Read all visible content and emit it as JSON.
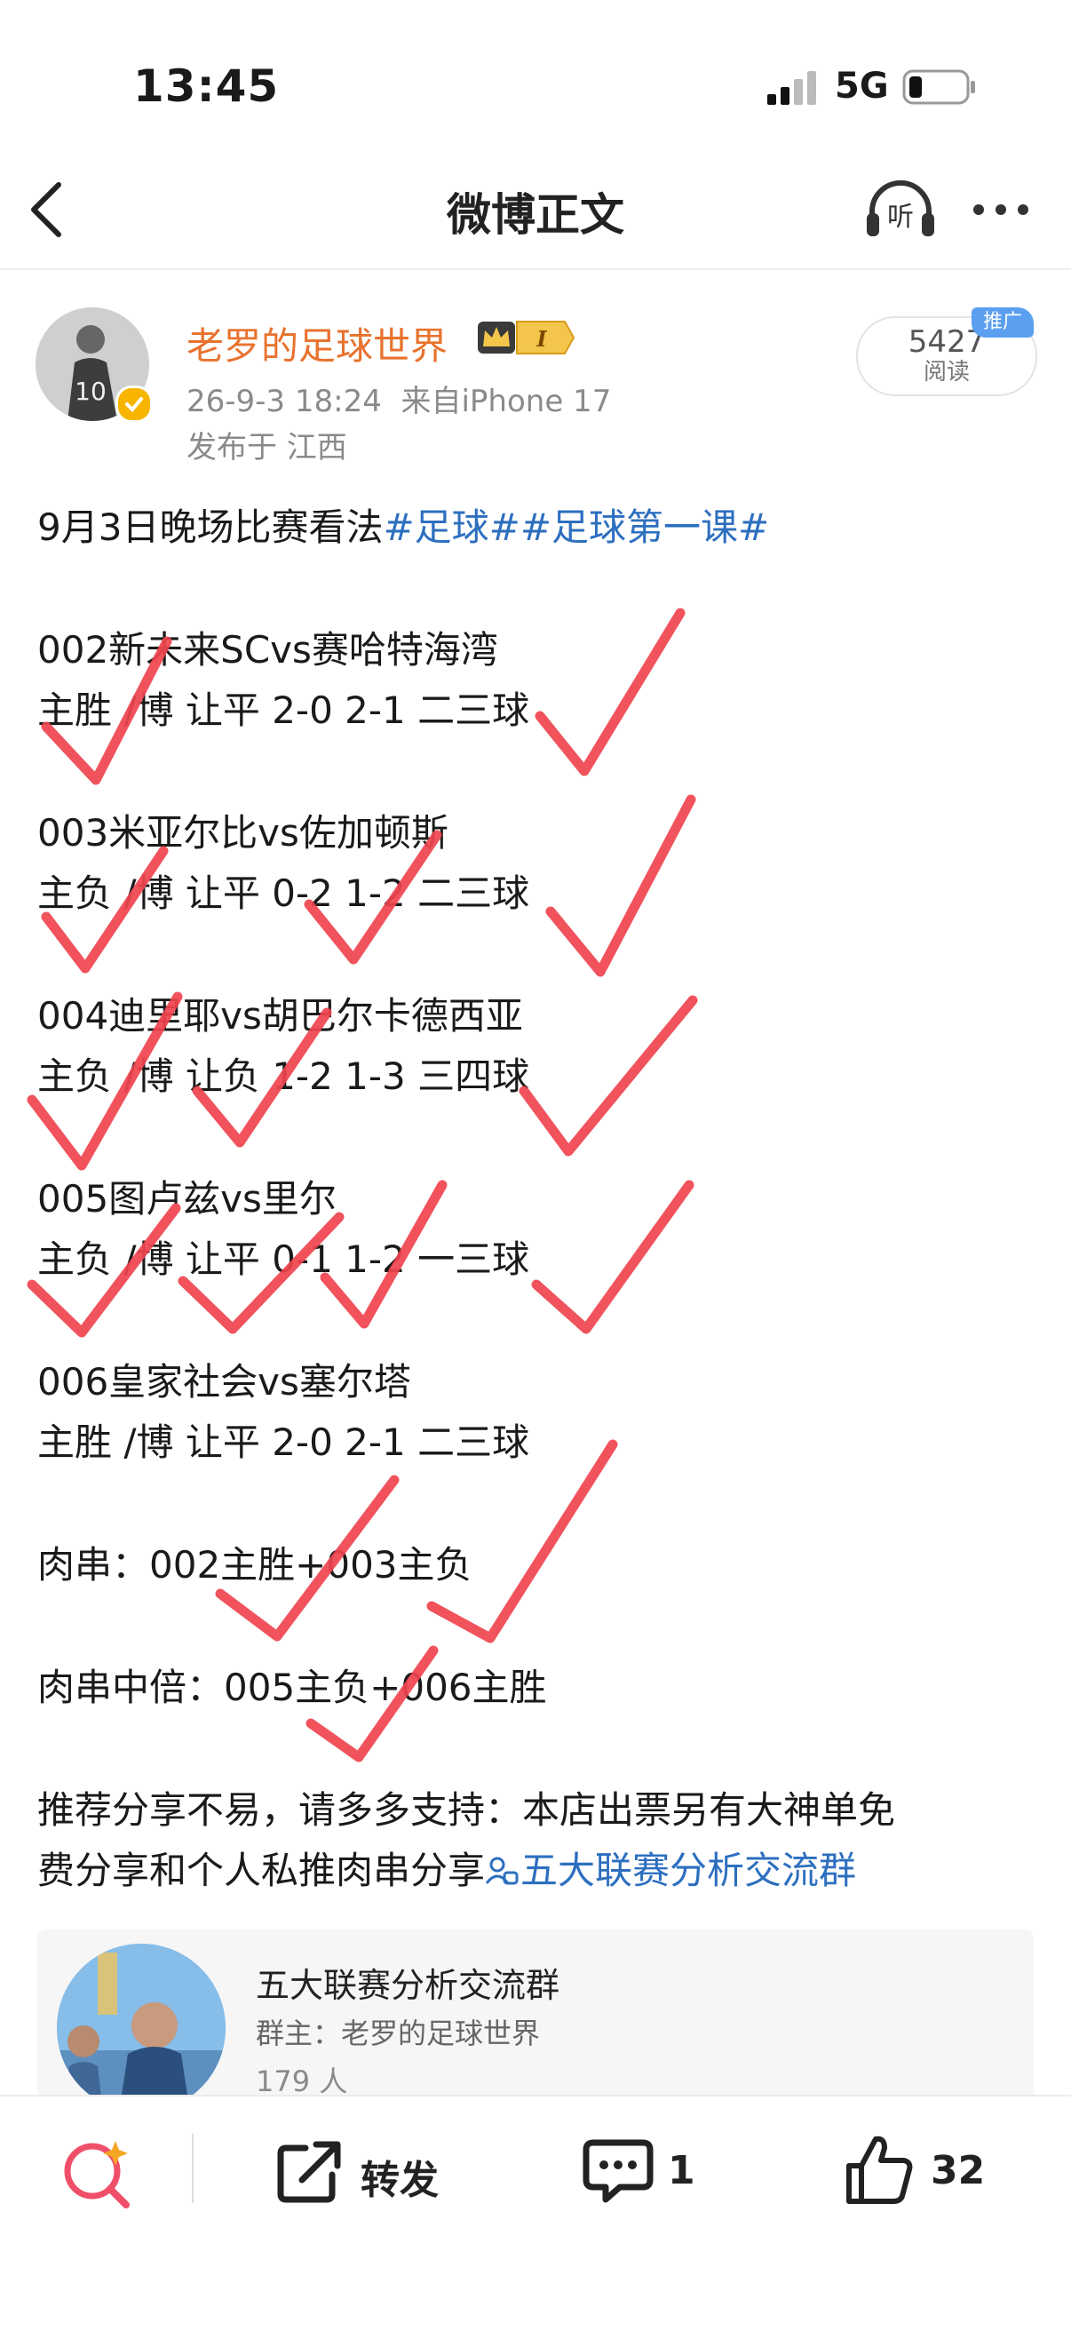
{
  "status_bar": {
    "time": "13:45",
    "network": "5G"
  },
  "nav": {
    "title": "微博正文"
  },
  "post": {
    "author": "老罗的足球世界",
    "time": "26-9-3 18:24",
    "source": "来自iPhone 17",
    "location": "发布于 江西",
    "read_count": "5427",
    "read_label": "阅读",
    "promo_badge": "推广",
    "level_badge": "I",
    "intro": "9月3日晚场比赛看法",
    "tags": [
      "#足球#",
      "#足球第一课#"
    ],
    "matches": [
      {
        "title": "002新未来SCvs赛哈特海湾",
        "pick": "主胜 /博 让平   2-0 2-1   二三球"
      },
      {
        "title": "003米亚尔比vs佐加顿斯",
        "pick": "主负 /博 让平   0-2 1-2   二三球"
      },
      {
        "title": "004迪里耶vs胡巴尔卡德西亚",
        "pick": "主负 /博 让负   1-2 1-3   三四球"
      },
      {
        "title": "005图卢兹vs里尔",
        "pick": "主负 /博 让平   0-1 1-2   一三球"
      },
      {
        "title": "006皇家社会vs塞尔塔",
        "pick": "主胜 /博 让平   2-0 2-1   二三球"
      }
    ],
    "parlay": "肉串：002主胜+003主负",
    "parlay_mid": "肉串中倍：005主负+006主胜",
    "closing_line1": "推荐分享不易，请多多支持：本店出票另有大神单免",
    "closing_line2": "费分享和个人私推肉串分享",
    "group_link": "五大联赛分析交流群"
  },
  "group_card": {
    "name": "五大联赛分析交流群",
    "owner": "群主：老罗的足球世界",
    "members": "179 人"
  },
  "bottom_bar": {
    "repost_label": "转发",
    "comment_count": "1",
    "like_count": "32"
  },
  "colors": {
    "author": "#e8722e",
    "link": "#2d6fbf",
    "check_marks": "#f0444f",
    "promo": "#5b9ff0"
  },
  "icons": [
    "back-icon",
    "listen-icon",
    "more-icon",
    "verified-icon",
    "crown-badge-icon",
    "group-icon",
    "search-ai-icon",
    "repost-icon",
    "comment-icon",
    "like-icon"
  ]
}
